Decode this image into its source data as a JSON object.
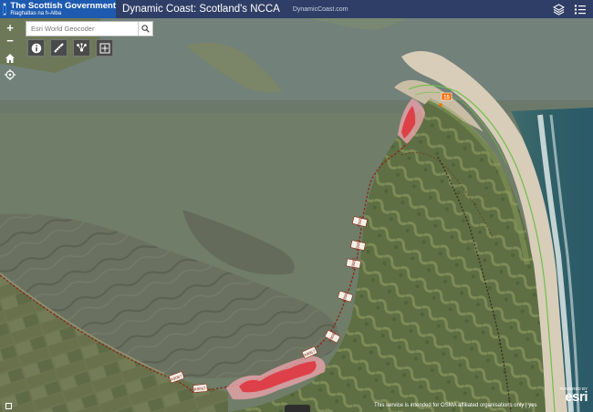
{
  "header": {
    "org_name": "The Scottish Government",
    "org_gaelic": "Riaghaltas na h-Alba",
    "title": "Dynamic Coast: Scotland's NCCA",
    "link": "DynamicCoast.com"
  },
  "search": {
    "placeholder": "Esri World Geocoder"
  },
  "toolbar": {
    "zoom_in": "+",
    "zoom_out": "−"
  },
  "map": {
    "road_labels": [
      "A9067",
      "A9067",
      "A9067",
      "A9067",
      "A9067",
      "A9067",
      "A9067",
      "A9067"
    ],
    "marker_label": "15"
  },
  "attribution": {
    "notice": "This service is intended for OSMA affiliated organisations only | yes",
    "powered_by": "POWERED BY",
    "esri": "esri"
  },
  "colors": {
    "header_bg": "#2f3e66",
    "erosion_zone": "#e0303a",
    "erosion_buffer": "#f2a7b0",
    "shoreline_line": "#6fbf4a",
    "road_line": "#8b2a1a"
  }
}
